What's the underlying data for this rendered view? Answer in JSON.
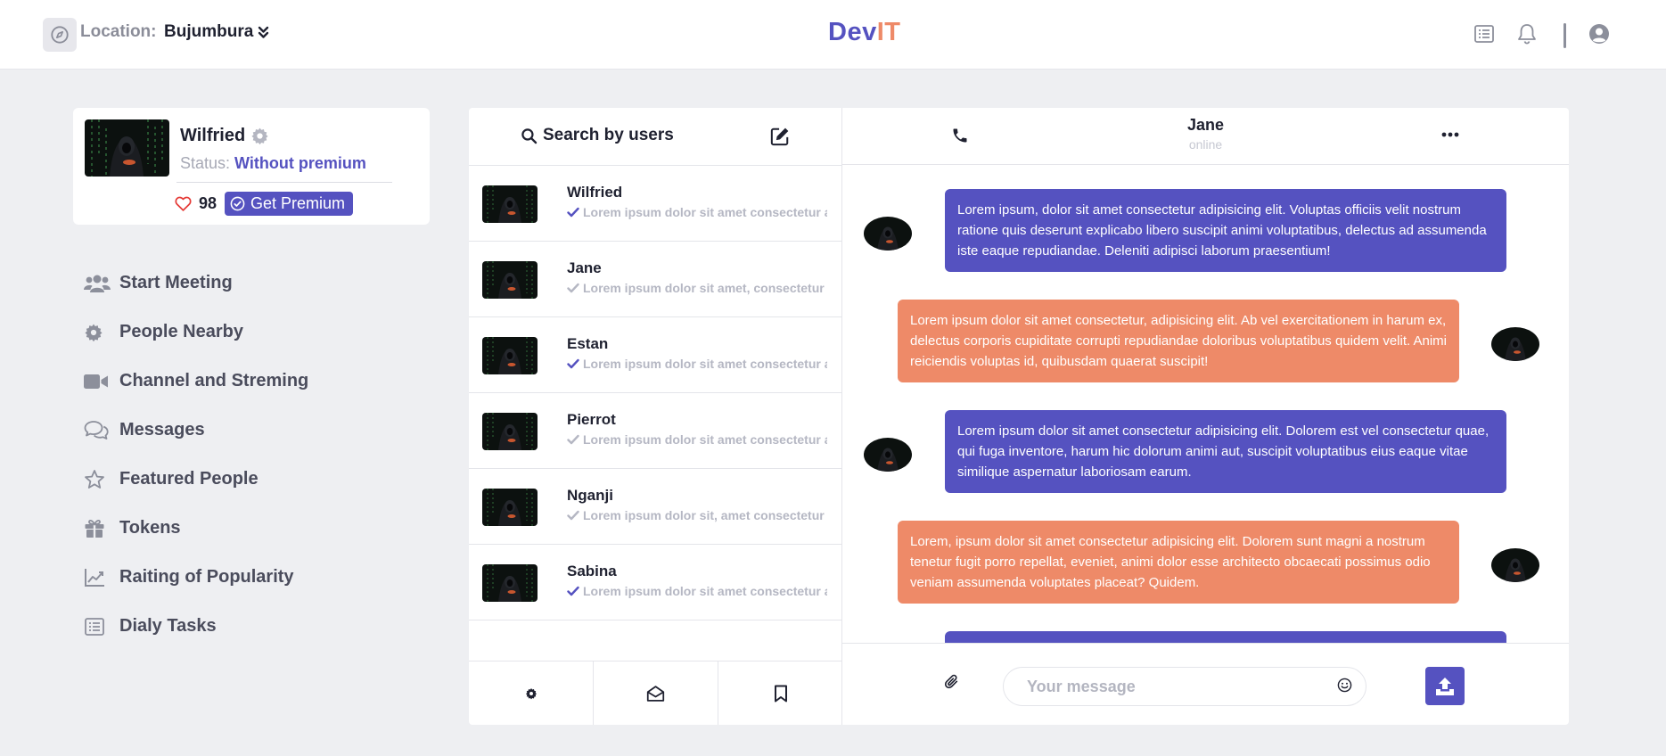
{
  "header": {
    "location_label": "Location:",
    "location_value": "Bujumbura",
    "brand_part1": "Dev",
    "brand_part2": "IT",
    "icons": [
      "compass-icon",
      "chevron-double-down-icon",
      "list-icon",
      "bell-icon",
      "user-circle-icon"
    ]
  },
  "profile": {
    "name": "Wilfried",
    "status_label": "Status:",
    "status_value": "Without premium",
    "likes": "98",
    "premium_label": "Get Premium"
  },
  "menu": [
    {
      "label": "Start Meeting",
      "icon": "users-icon"
    },
    {
      "label": "People Nearby",
      "icon": "gear-icon"
    },
    {
      "label": "Channel and Streming",
      "icon": "video-icon"
    },
    {
      "label": "Messages",
      "icon": "chat-icon"
    },
    {
      "label": "Featured People",
      "icon": "star-icon"
    },
    {
      "label": "Tokens",
      "icon": "gift-icon"
    },
    {
      "label": "Raiting of Popularity",
      "icon": "chart-line-icon"
    },
    {
      "label": "Dialy Tasks",
      "icon": "list-icon"
    }
  ],
  "users_panel": {
    "search_label": "Search by users",
    "users": [
      {
        "name": "Wilfried",
        "preview": "Lorem ipsum dolor sit amet consectetur adipisicing elit.",
        "read": true
      },
      {
        "name": "Jane",
        "preview": "Lorem ipsum dolor sit amet, consectetur adipisicing elit.",
        "read": false
      },
      {
        "name": "Estan",
        "preview": "Lorem ipsum dolor sit amet consectetur adipisicing elit.",
        "read": true
      },
      {
        "name": "Pierrot",
        "preview": "Lorem ipsum dolor sit amet consectetur adipisicing elit.",
        "read": false
      },
      {
        "name": "Nganji",
        "preview": "Lorem ipsum dolor sit, amet consectetur adipisicing elit.",
        "read": false
      },
      {
        "name": "Sabina",
        "preview": "Lorem ipsum dolor sit amet consectetur adipisicing elit.",
        "read": true
      }
    ],
    "tabs": [
      "gear-icon",
      "envelope-open-icon",
      "bookmark-icon"
    ]
  },
  "chat": {
    "contact_name": "Jane",
    "contact_status": "online",
    "messages": [
      {
        "side": "in",
        "text": "Lorem ipsum, dolor sit amet consectetur adipisicing elit. Voluptas officiis velit nostrum ratione quis deserunt explicabo libero suscipit animi voluptatibus, delectus ad assumenda iste eaque repudiandae. Deleniti adipisci laborum praesentium!"
      },
      {
        "side": "out",
        "text": "Lorem ipsum dolor sit amet consectetur, adipisicing elit. Ab vel exercitationem in harum ex, delectus corporis cupiditate corrupti repudiandae doloribus voluptatibus quidem velit. Animi reiciendis voluptas id, quibusdam quaerat suscipit!"
      },
      {
        "side": "in",
        "text": "Lorem ipsum dolor sit amet consectetur adipisicing elit. Dolorem est vel consectetur quae, qui fuga inventore, harum hic dolorum animi aut, suscipit voluptatibus eius eaque vitae similique aspernatur laboriosam earum."
      },
      {
        "side": "out",
        "text": "Lorem, ipsum dolor sit amet consectetur adipisicing elit. Dolorem sunt magni a nostrum tenetur fugit porro repellat, eveniet, animi dolor esse architecto obcaecati possimus odio veniam assumenda voluptates placeat? Quidem."
      },
      {
        "side": "in",
        "text": ""
      }
    ],
    "input_placeholder": "Your message",
    "input_value": ""
  },
  "colors": {
    "accent": "#5552c0",
    "accent_secondary": "#ee8a68",
    "background": "#eeeff2",
    "muted_text": "#b5b7c3",
    "heart": "#e53935"
  }
}
